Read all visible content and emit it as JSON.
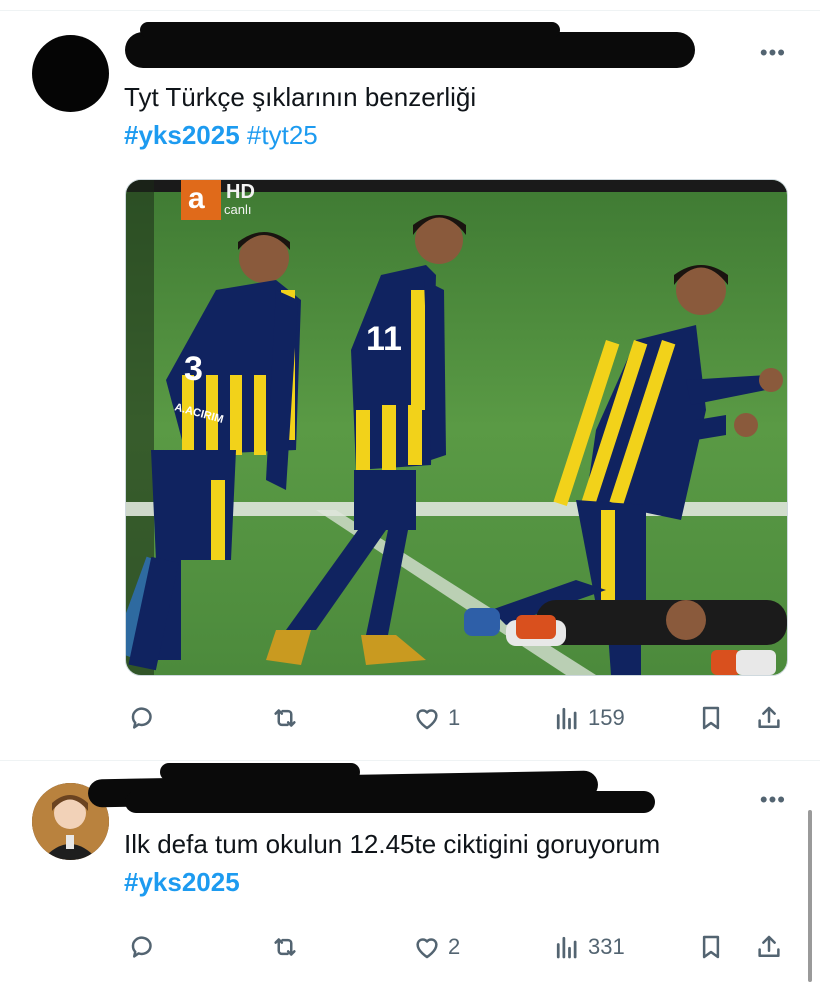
{
  "tweets": [
    {
      "text": "Tyt Türkçe şıklarının benzerliği",
      "hashtags": [
        "#yks2025",
        "#tyt25"
      ],
      "media": {
        "channel_logo": "a",
        "channel_hd": "HD",
        "channel_live": "canlı",
        "player_numbers": [
          "3",
          "11"
        ],
        "player_names": [
          "A.ACIRIM"
        ]
      },
      "actions": {
        "reply": "",
        "retweet": "",
        "like": "1",
        "views": "159"
      }
    },
    {
      "text": "Ilk defa tum okulun 12.45te ciktigini goruyorum",
      "hashtags": [
        "#yks2025"
      ],
      "actions": {
        "reply": "",
        "retweet": "",
        "like": "2",
        "views": "331"
      }
    }
  ],
  "icons": [
    "more-icon",
    "reply-icon",
    "retweet-icon",
    "like-icon",
    "views-icon",
    "bookmark-icon",
    "share-icon"
  ],
  "colors": {
    "link": "#1d9bf0",
    "muted": "#536471",
    "text": "#0f1419",
    "pitch": "#4f8d3e"
  }
}
